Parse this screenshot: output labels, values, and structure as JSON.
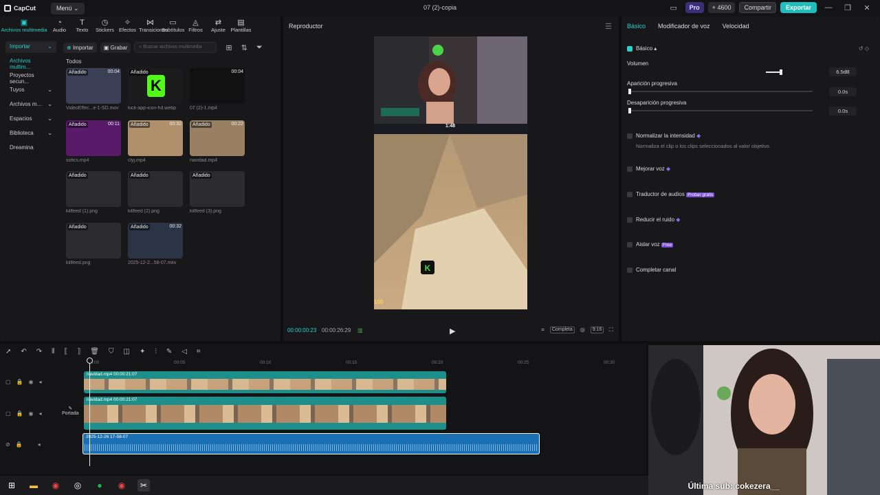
{
  "app": {
    "logo": "CapCut",
    "menu": "Menú",
    "project_title": "07 (2)-copia"
  },
  "topbar": {
    "pro": "Pro",
    "credits": "4600",
    "share": "Compartir",
    "export": "Exportar"
  },
  "toolstrip": [
    {
      "label": "Archivos multimedia",
      "icon": "▣"
    },
    {
      "label": "Audio",
      "icon": "◔"
    },
    {
      "label": "Texto",
      "icon": "T"
    },
    {
      "label": "Stickers",
      "icon": "◷"
    },
    {
      "label": "Efectos",
      "icon": "✧"
    },
    {
      "label": "Transiciones",
      "icon": "⋈"
    },
    {
      "label": "Subtítulos",
      "icon": "▭"
    },
    {
      "label": "Filtros",
      "icon": "◬"
    },
    {
      "label": "Ajuste",
      "icon": "⇄"
    },
    {
      "label": "Plantillas",
      "icon": "▤"
    }
  ],
  "sidebar": [
    "Importar",
    "Archivos multim...",
    "Proyectos secun...",
    "Tuyos",
    "Archivos m...",
    "Espacios",
    "Biblioteca",
    "Dreamina"
  ],
  "media_top": {
    "import": "Importar",
    "record": "Grabar",
    "search_placeholder": "Buscar archivos multimedia"
  },
  "media_section": "Todos",
  "media_items": [
    {
      "name": "VideoEffec...e-1-SD.mov",
      "added": "Añadido",
      "dur": "00:04"
    },
    {
      "name": "kick-app-icon-hd.webp",
      "added": "Añadido",
      "dur": ""
    },
    {
      "name": "07 (2)-1.mp4",
      "added": "",
      "dur": "00:04"
    },
    {
      "name": "sofics.mp4",
      "added": "Añadido",
      "dur": "00:11"
    },
    {
      "name": "clyj.mp4",
      "added": "Añadido",
      "dur": "00:32"
    },
    {
      "name": "navidad.mp4",
      "added": "Añadido",
      "dur": "00:22"
    },
    {
      "name": "killfeed (1).png",
      "added": "Añadido",
      "dur": ""
    },
    {
      "name": "killfeed (2).png",
      "added": "Añadido",
      "dur": ""
    },
    {
      "name": "killfeed (3).png",
      "added": "Añadido",
      "dur": ""
    },
    {
      "name": "killfeed.png",
      "added": "Añadido",
      "dur": ""
    },
    {
      "name": "2025-12-2...58-07.mkv",
      "added": "Añadido",
      "dur": "00:32"
    }
  ],
  "player": {
    "title": "Reproductor",
    "current": "00:00:00:23",
    "total": "00:00:26:29",
    "complete": "Completa",
    "ratio": "9:16",
    "hud_time": "1:48"
  },
  "inspector": {
    "tabs": [
      "Básico",
      "Modificador de voz",
      "Velocidad"
    ],
    "section": "Básico",
    "volume_label": "Volumen",
    "volume_value": "6.5dB",
    "fadein_label": "Aparición progresiva",
    "fadein_value": "0.0s",
    "fadeout_label": "Desaparición progresiva",
    "fadeout_value": "0.0s",
    "normalize": "Normalizar la intensidad",
    "normalize_desc": "Normaliza el clip o los clips seleccionados al valor objetivo.",
    "improve": "Mejorar voz",
    "translate": "Traductor de audios",
    "translate_badge": "Probar gratis",
    "noise": "Reducir el ruido",
    "isolate": "Aislar voz",
    "isolate_badge": "Free",
    "complete": "Completar canal"
  },
  "timeline": {
    "ruler": [
      "00:00",
      "00:05",
      "00:10",
      "00:15",
      "00:20",
      "00:25",
      "00:30"
    ],
    "clip1": "navidad.mp4  00:00:21:07",
    "clip2": "navidad.mp4  00:00:21:07",
    "clip3": "2025-12-26 17-58-07",
    "cover": "Portada"
  },
  "overlay": {
    "sub": "Última sub: cokezera__"
  },
  "colors": {
    "accent": "#26d0ce",
    "clip": "#1d8f8a",
    "audio": "#1b6fb5"
  }
}
